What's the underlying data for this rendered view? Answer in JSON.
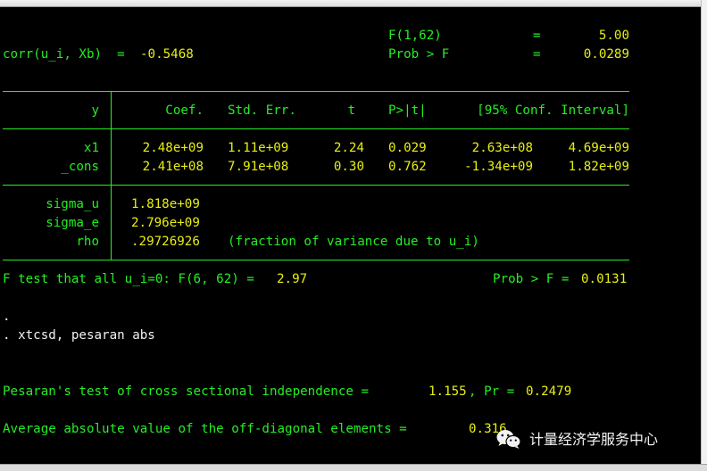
{
  "header": {
    "f_label": "F(1,62)",
    "f_eq": "=",
    "f_value": "5.00",
    "prob_label": "Prob > F",
    "prob_eq": "=",
    "prob_value": "0.0289",
    "corr_label": "corr(u_i, Xb)  =",
    "corr_value": "-0.5468"
  },
  "table": {
    "depvar": "y",
    "columns": [
      "Coef.",
      "Std. Err.",
      "t",
      "P>|t|",
      "[95% Conf. Interval]"
    ],
    "rows": [
      {
        "name": "x1",
        "coef": "2.48e+09",
        "se": "1.11e+09",
        "t": "2.24",
        "p": "0.029",
        "lo": "2.63e+08",
        "hi": "4.69e+09"
      },
      {
        "name": "_cons",
        "coef": "2.41e+08",
        "se": "7.91e+08",
        "t": "0.30",
        "p": "0.762",
        "lo": "-1.34e+09",
        "hi": "1.82e+09"
      }
    ],
    "sigma_u_label": "sigma_u",
    "sigma_u_value": "1.818e+09",
    "sigma_e_label": "sigma_e",
    "sigma_e_value": "2.796e+09",
    "rho_label": "rho",
    "rho_value": ".29726926",
    "rho_note": "(fraction of variance due to u_i)"
  },
  "ftest": {
    "label": "F test that all u_i=0: F(6, 62) =",
    "value": "2.97",
    "prob_label": "Prob > F =",
    "prob_value": "0.0131"
  },
  "commands": {
    "dot": ".",
    "cmd": ". xtcsd, pesaran abs"
  },
  "pesaran": {
    "label": "Pesaran's test of cross sectional independence =",
    "stat": "1.155",
    "pr_label": ", Pr =",
    "pr_value": "0.2479",
    "avg_label": "Average absolute value of the off-diagonal elements =",
    "avg_value": "0.316"
  },
  "watermark": {
    "text": "计量经济学服务中心",
    "icon": "wechat-icon"
  }
}
